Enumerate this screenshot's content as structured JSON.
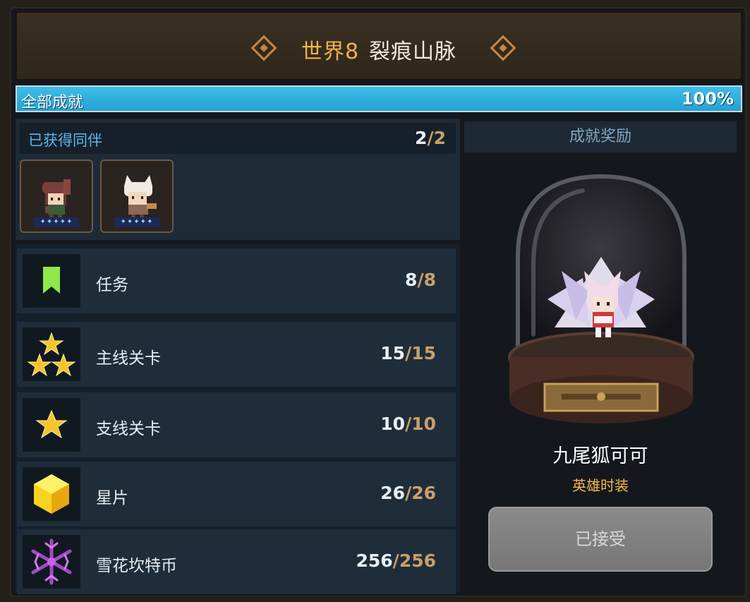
{
  "header": {
    "world": "世界8",
    "name": "裂痕山脉"
  },
  "progress": {
    "label": "全部成就",
    "percent_text": "100%",
    "fraction": 1.0
  },
  "companions": {
    "title": "已获得同伴",
    "current": "2",
    "separator": "/",
    "total": "2",
    "heroes": [
      {
        "stars": "✦✦✦✦✦"
      },
      {
        "stars": "✦✦✦✦✦"
      }
    ]
  },
  "rows": [
    {
      "label": "任务",
      "current": "8",
      "total": "8",
      "icon": "bookmark-icon"
    },
    {
      "label": "主线关卡",
      "current": "15",
      "total": "15",
      "icon": "three-stars-icon"
    },
    {
      "label": "支线关卡",
      "current": "10",
      "total": "10",
      "icon": "star-icon"
    },
    {
      "label": "星片",
      "current": "26",
      "total": "26",
      "icon": "star-piece-cube-icon"
    },
    {
      "label": "雪花坎特币",
      "current": "256",
      "total": "256",
      "icon": "snowflake-coin-icon"
    }
  ],
  "reward": {
    "title": "成就奖励",
    "name": "九尾狐可可",
    "type": "英雄时装",
    "button": "已接受"
  },
  "colors": {
    "accent_gold": "#f2b14a",
    "progress_blue": "#23a2d3",
    "label_blue": "#5fb6ea"
  }
}
